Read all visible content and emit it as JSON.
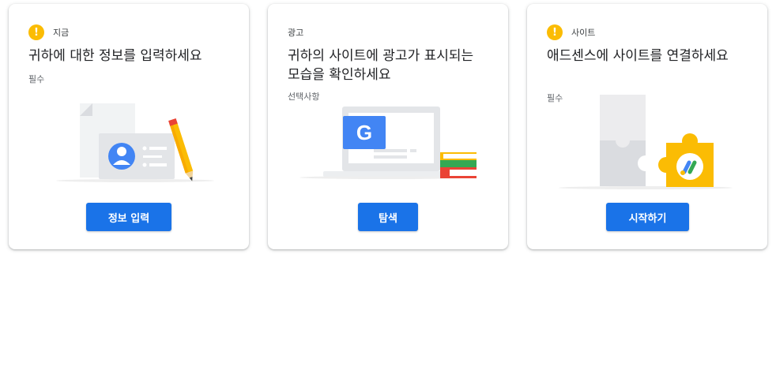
{
  "cards": [
    {
      "tag": "지금",
      "title": "귀하에 대한 정보를 입력하세요",
      "requirement": "필수",
      "button": "정보 입력",
      "illustration": "id-card-with-pencil"
    },
    {
      "tag": "광고",
      "title": "귀하의 사이트에 광고가 표시되는 모습을 확인하세요",
      "requirement": "선택사항",
      "button": "탐색",
      "illustration": "laptop-with-google-and-books"
    },
    {
      "tag": "사이트",
      "title": "애드센스에 사이트를 연결하세요",
      "requirement": "필수",
      "button": "시작하기",
      "illustration": "puzzle-pieces-adsense"
    }
  ],
  "icons": {
    "warning": "!",
    "google_letter": "G"
  },
  "colors": {
    "primary_button": "#1a73e8",
    "warning": "#fbbc04",
    "google_blue": "#4285f4"
  }
}
